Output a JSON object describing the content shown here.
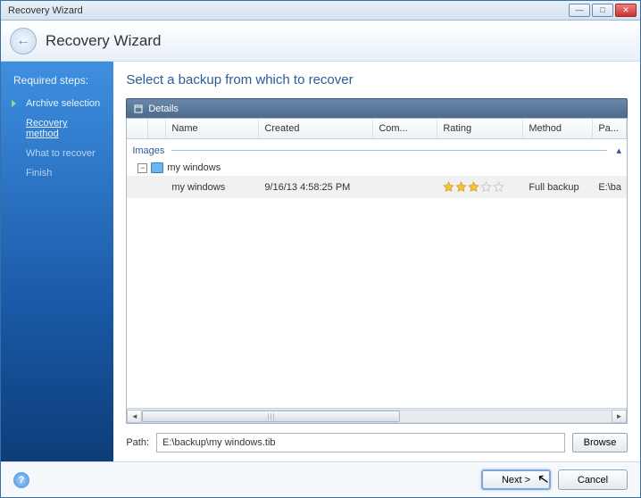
{
  "window": {
    "title": "Recovery Wizard"
  },
  "header": {
    "title": "Recovery Wizard"
  },
  "sidebar": {
    "heading": "Required steps:",
    "items": [
      {
        "label": "Archive selection"
      },
      {
        "label": "Recovery method"
      },
      {
        "label": "What to recover"
      },
      {
        "label": "Finish"
      }
    ],
    "bottom1": "",
    "bottom2": ""
  },
  "main": {
    "heading": "Select a backup from which to recover",
    "details_label": "Details",
    "columns": {
      "name": "Name",
      "created": "Created",
      "com": "Com...",
      "rating": "Rating",
      "method": "Method",
      "path": "Pa..."
    },
    "group_label": "Images",
    "archive_name": "my windows",
    "row": {
      "name": "my windows",
      "created": "9/16/13 4:58:25 PM",
      "com": "",
      "rating_filled": 3,
      "rating_total": 5,
      "method": "Full backup",
      "path": "E:\\ba"
    },
    "path_label": "Path:",
    "path_value": "E:\\backup\\my windows.tib",
    "browse_label": "Browse"
  },
  "footer": {
    "next": "Next >",
    "cancel": "Cancel"
  }
}
